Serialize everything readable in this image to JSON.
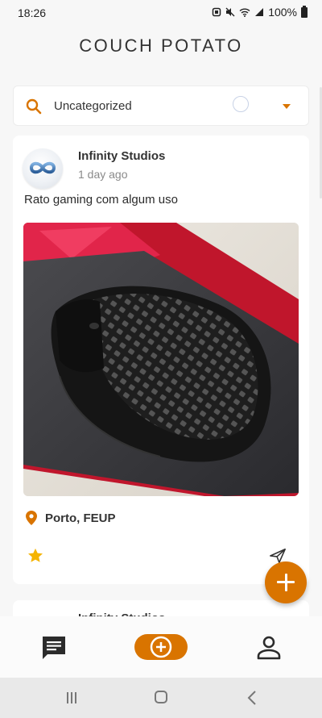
{
  "status_bar": {
    "time": "18:26",
    "battery": "100%"
  },
  "app": {
    "title": "COUCH POTATO",
    "accent_color": "#d97400"
  },
  "category_filter": {
    "icon": "search-icon",
    "selected": "Uncategorized"
  },
  "post": {
    "author": "Infinity Studios",
    "time_ago": "1 day ago",
    "title": "Rato gaming com algum uso",
    "image_description_icon": "gaming-mouse-photo",
    "location": "Porto, FEUP",
    "favorited": true
  },
  "next_post": {
    "author": "Infinity Studios"
  },
  "bottom_nav": {
    "items": [
      {
        "name": "chat",
        "icon": "chat-icon"
      },
      {
        "name": "add",
        "icon": "add-circle-icon",
        "active": true
      },
      {
        "name": "profile",
        "icon": "person-icon"
      }
    ]
  }
}
